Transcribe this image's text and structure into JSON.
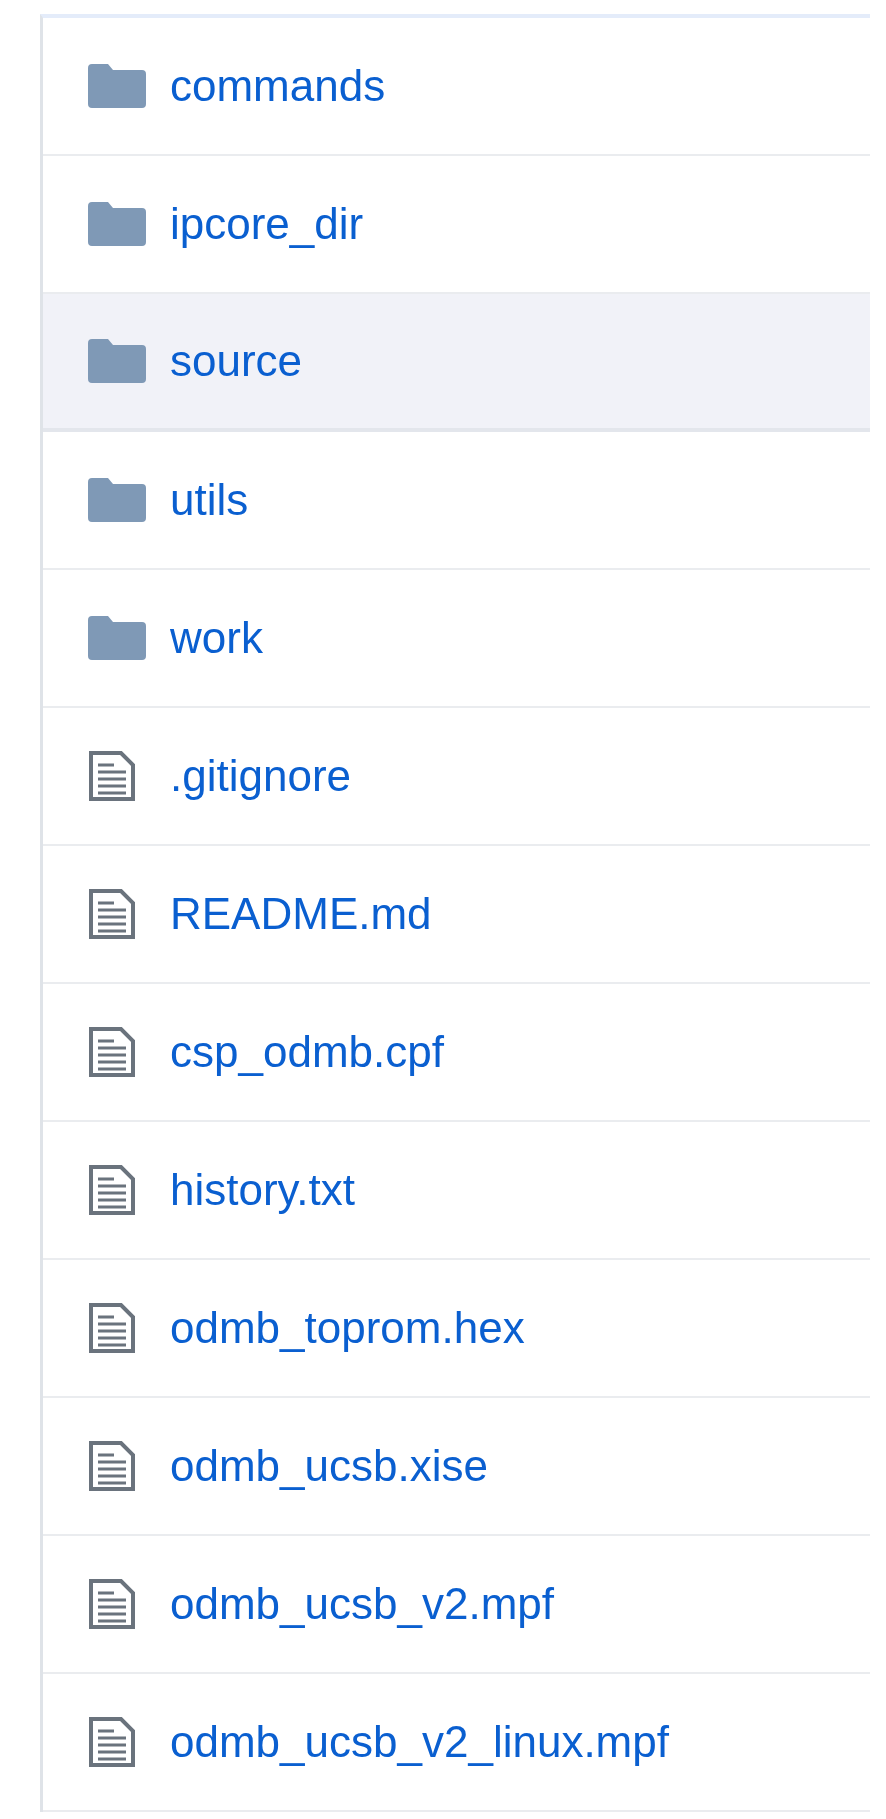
{
  "files": [
    {
      "kind": "folder",
      "name": "commands",
      "selected": false
    },
    {
      "kind": "folder",
      "name": "ipcore_dir",
      "selected": false
    },
    {
      "kind": "folder",
      "name": "source",
      "selected": true
    },
    {
      "kind": "folder",
      "name": "utils",
      "selected": false
    },
    {
      "kind": "folder",
      "name": "work",
      "selected": false
    },
    {
      "kind": "file",
      "name": ".gitignore",
      "selected": false
    },
    {
      "kind": "file",
      "name": "README.md",
      "selected": false
    },
    {
      "kind": "file",
      "name": "csp_odmb.cpf",
      "selected": false
    },
    {
      "kind": "file",
      "name": "history.txt",
      "selected": false
    },
    {
      "kind": "file",
      "name": "odmb_toprom.hex",
      "selected": false
    },
    {
      "kind": "file",
      "name": "odmb_ucsb.xise",
      "selected": false
    },
    {
      "kind": "file",
      "name": "odmb_ucsb_v2.mpf",
      "selected": false
    },
    {
      "kind": "file",
      "name": "odmb_ucsb_v2_linux.mpf",
      "selected": false
    }
  ]
}
